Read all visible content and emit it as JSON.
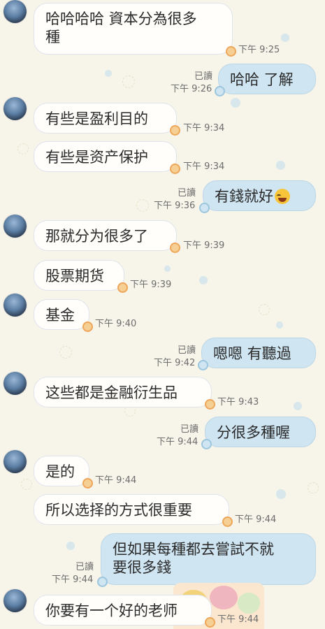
{
  "read_label": "已讀",
  "messages": [
    {
      "dir": "in",
      "text": "哈哈哈哈 資本分為很多",
      "text2": "種",
      "time": "下午 9:25",
      "avatar": true
    },
    {
      "dir": "out",
      "text": "哈哈 了解",
      "time": "下午 9:26",
      "read": true
    },
    {
      "dir": "in",
      "text": "有些是盈利目的",
      "time": "下午 9:34",
      "avatar": true
    },
    {
      "dir": "in",
      "text": "有些是资产保护",
      "time": "下午 9:34"
    },
    {
      "dir": "out",
      "text": "有錢就好",
      "emoji": "tears-of-joy-emoji",
      "time": "下午 9:36",
      "read": true
    },
    {
      "dir": "in",
      "text": "那就分为很多了",
      "time": "下午 9:39",
      "avatar": true
    },
    {
      "dir": "in",
      "text": "股票期货",
      "time": "下午 9:39"
    },
    {
      "dir": "in",
      "text": "基金",
      "time": "下午 9:40",
      "avatar": true
    },
    {
      "dir": "out",
      "text": "嗯嗯 有聽過",
      "time": "下午 9:42",
      "read": true
    },
    {
      "dir": "in",
      "text": "这些都是金融衍生品",
      "time": "下午 9:43",
      "avatar": true
    },
    {
      "dir": "out",
      "text": "分很多種喔",
      "time": "下午 9:44",
      "read": true
    },
    {
      "dir": "in",
      "text": "是的",
      "time": "下午 9:44",
      "avatar": true
    },
    {
      "dir": "in",
      "text": "所以选择的方式很重要",
      "time": "下午 9:44"
    },
    {
      "dir": "out",
      "text": "但如果每種都去嘗試不就",
      "text2": "要很多錢",
      "time": "下午 9:44",
      "read": true
    },
    {
      "dir": "in",
      "text": "你要有一个好的老师",
      "time": "下午 9:44",
      "avatar": true
    }
  ]
}
